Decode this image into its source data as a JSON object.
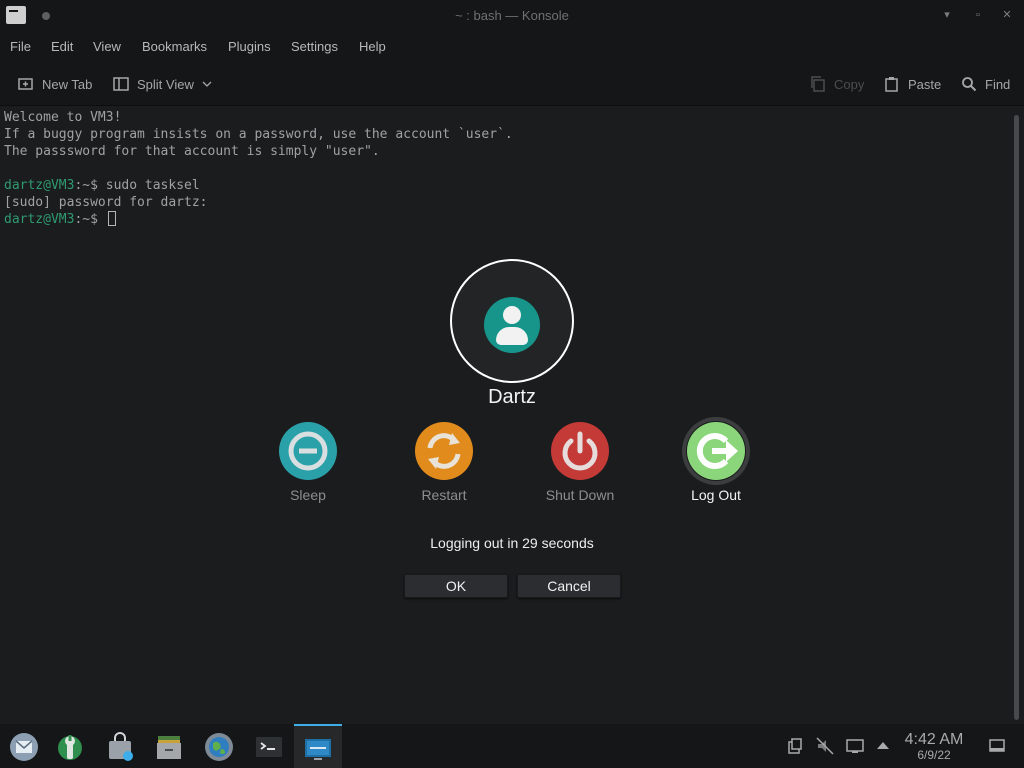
{
  "window": {
    "title": "~ : bash — Konsole",
    "minimize_glyph": "▾",
    "maximize_glyph": "▫",
    "close_glyph": "✕"
  },
  "menu": [
    "File",
    "Edit",
    "View",
    "Bookmarks",
    "Plugins",
    "Settings",
    "Help"
  ],
  "toolbar": {
    "new_tab": "New Tab",
    "split_view": "Split View",
    "copy": "Copy",
    "paste": "Paste",
    "find": "Find"
  },
  "terminal": {
    "welcome": "Welcome to VM3!",
    "line2": "If a buggy program insists on a password, use the account `user`.",
    "line3": "The passsword for that account is simply \"user\".",
    "prompt_user": "dartz@VM3",
    "prompt_suffix": ":~$ ",
    "command1": "sudo tasksel",
    "sudo_prompt": "[sudo] password for dartz:"
  },
  "logout_dialog": {
    "username": "Dartz",
    "actions": {
      "sleep": "Sleep",
      "restart": "Restart",
      "shutdown": "Shut Down",
      "logout": "Log Out"
    },
    "countdown": "Logging out in 29 seconds",
    "ok": "OK",
    "cancel": "Cancel"
  },
  "taskbar": {
    "time": "4:42 AM",
    "date": "6/9/22"
  },
  "colors": {
    "accent": "#3daee9",
    "prompt_green": "#2f9a70",
    "sleep": "#2aa1a9",
    "restart": "#e08b1c",
    "shutdown": "#c43a37",
    "logout": "#8bd67a",
    "avatar": "#17958a"
  }
}
